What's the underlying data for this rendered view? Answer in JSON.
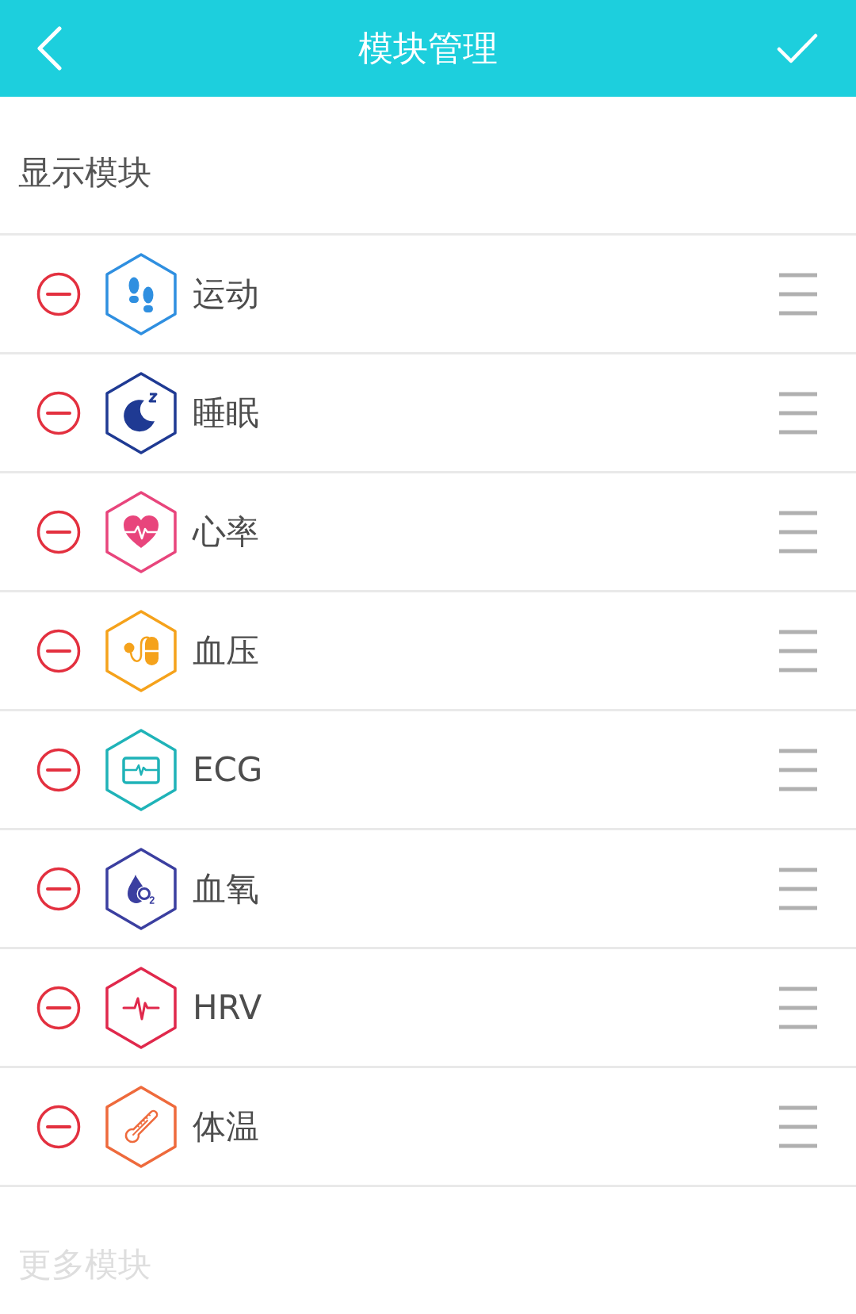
{
  "header": {
    "title": "模块管理"
  },
  "shown_section": {
    "heading": "显示模块",
    "modules": [
      {
        "kind": "steps",
        "label": "运动",
        "color": "#2f8fe0"
      },
      {
        "kind": "sleep",
        "label": "睡眠",
        "color": "#1f3a93"
      },
      {
        "kind": "heart",
        "label": "心率",
        "color": "#e8457c"
      },
      {
        "kind": "pressure",
        "label": "血压",
        "color": "#f5a21b"
      },
      {
        "kind": "ecg",
        "label": "ECG",
        "color": "#1fb3b8"
      },
      {
        "kind": "oxygen",
        "label": "血氧",
        "color": "#3b3fa0"
      },
      {
        "kind": "pulse",
        "label": "HRV",
        "color": "#e0284c"
      },
      {
        "kind": "thermometer",
        "label": "体温",
        "color": "#ee6a3c"
      }
    ]
  },
  "more_section": {
    "heading": "更多模块"
  }
}
